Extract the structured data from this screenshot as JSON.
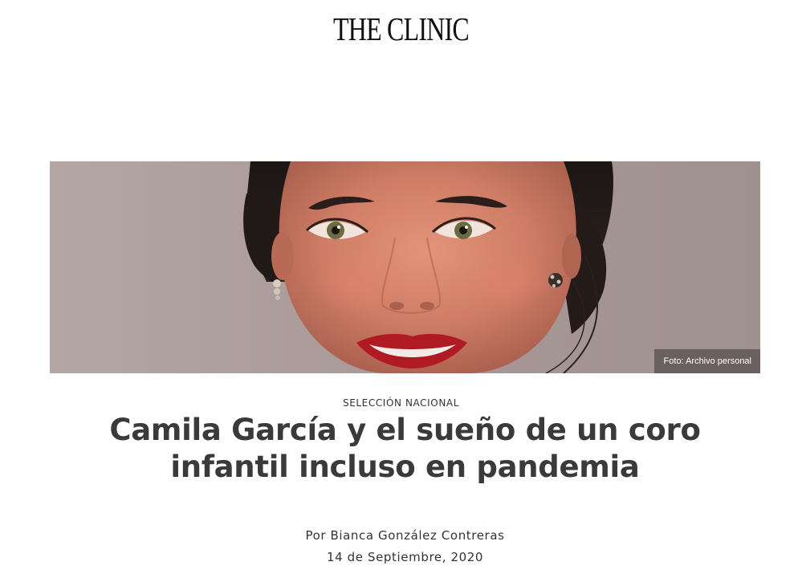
{
  "header": {
    "logo_text": "THE CLINIC"
  },
  "hero": {
    "photo_credit": "Foto: Archivo personal",
    "image_subject": "portrait-photo"
  },
  "article": {
    "category": "SELECCIÓN NACIONAL",
    "title": "Camila García y el sueño de un coro infantil incluso en pandemia",
    "byline": "Por Bianca González Contreras",
    "date": "14 de Septiembre, 2020"
  },
  "colors": {
    "title_text": "#3a3a3a",
    "body_text": "#333333",
    "photo_background": "#a99a97",
    "lips": "#b01a22"
  }
}
